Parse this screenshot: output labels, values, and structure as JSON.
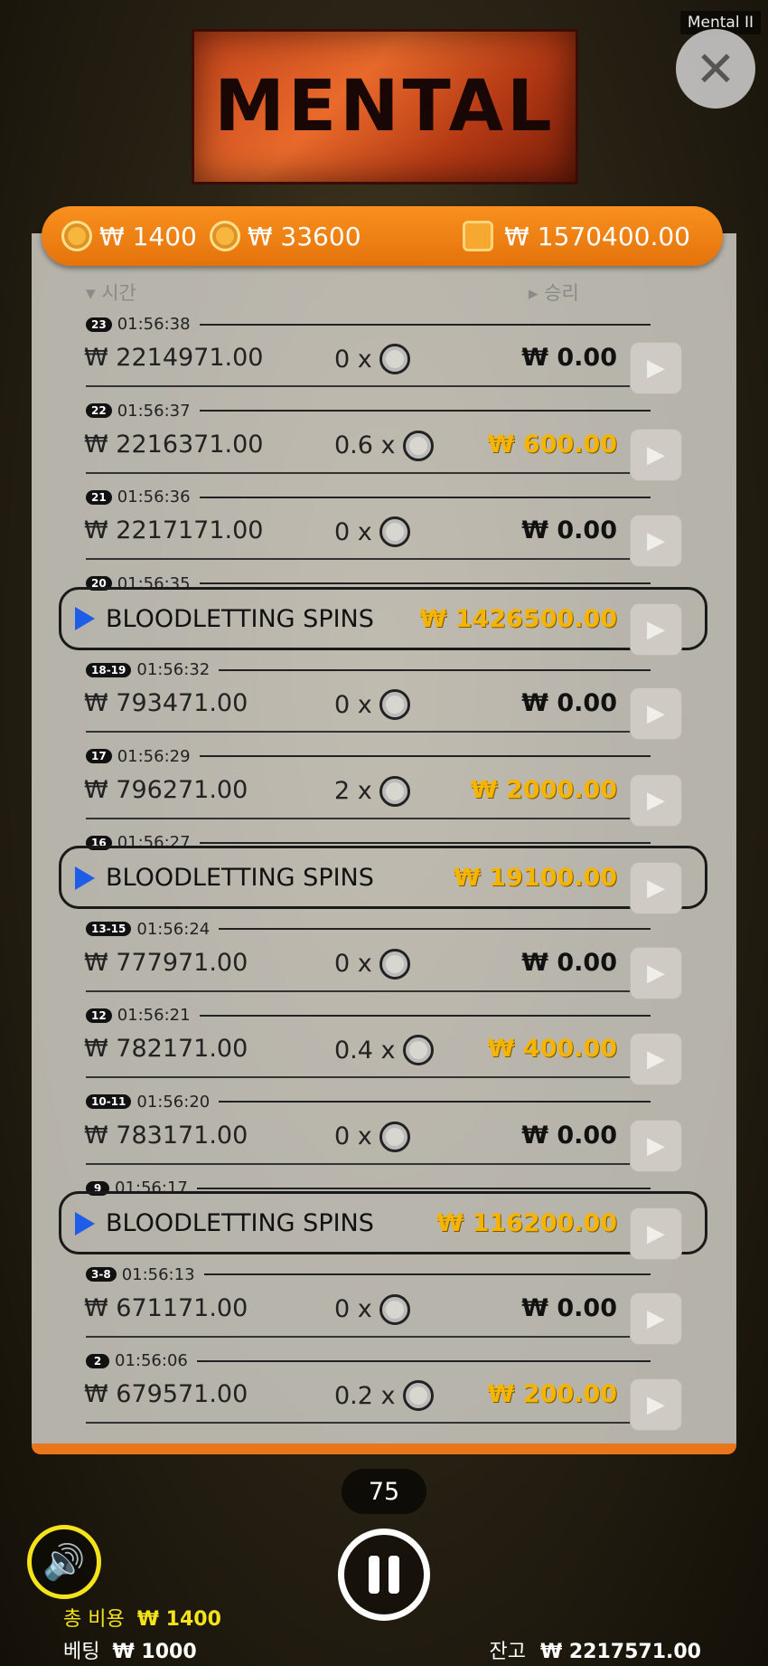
{
  "window": {
    "title": "Mental II"
  },
  "logo": {
    "text": "MENTAL"
  },
  "balance_bar": {
    "bet_coin_value": "₩ 1400",
    "second_coin_value": "₩ 33600",
    "wallet_value": "₩ 1570400.00"
  },
  "columns": {
    "time": "시간",
    "win": "승리"
  },
  "rounds": [
    {
      "badge": "23",
      "time": "01:56:38",
      "amount": "₩ 2214971.00",
      "multiplier": "0 x",
      "win": "₩ 0.00",
      "gold": false,
      "bonus": false
    },
    {
      "badge": "22",
      "time": "01:56:37",
      "amount": "₩ 2216371.00",
      "multiplier": "0.6 x",
      "win": "₩ 600.00",
      "gold": true,
      "bonus": false
    },
    {
      "badge": "21",
      "time": "01:56:36",
      "amount": "₩ 2217171.00",
      "multiplier": "0 x",
      "win": "₩ 0.00",
      "gold": false,
      "bonus": false
    },
    {
      "badge": "20",
      "time": "01:56:35",
      "label": "BLOODLETTING SPINS",
      "win": "₩ 1426500.00",
      "gold": true,
      "bonus": true
    },
    {
      "badge": "18-19",
      "time": "01:56:32",
      "amount": "₩ 793471.00",
      "multiplier": "0 x",
      "win": "₩ 0.00",
      "gold": false,
      "bonus": false
    },
    {
      "badge": "17",
      "time": "01:56:29",
      "amount": "₩ 796271.00",
      "multiplier": "2 x",
      "win": "₩ 2000.00",
      "gold": true,
      "bonus": false
    },
    {
      "badge": "16",
      "time": "01:56:27",
      "label": "BLOODLETTING SPINS",
      "win": "₩ 19100.00",
      "gold": true,
      "bonus": true
    },
    {
      "badge": "13-15",
      "time": "01:56:24",
      "amount": "₩ 777971.00",
      "multiplier": "0 x",
      "win": "₩ 0.00",
      "gold": false,
      "bonus": false
    },
    {
      "badge": "12",
      "time": "01:56:21",
      "amount": "₩ 782171.00",
      "multiplier": "0.4 x",
      "win": "₩ 400.00",
      "gold": true,
      "bonus": false
    },
    {
      "badge": "10-11",
      "time": "01:56:20",
      "amount": "₩ 783171.00",
      "multiplier": "0 x",
      "win": "₩ 0.00",
      "gold": false,
      "bonus": false
    },
    {
      "badge": "9",
      "time": "01:56:17",
      "label": "BLOODLETTING SPINS",
      "win": "₩ 116200.00",
      "gold": true,
      "bonus": true
    },
    {
      "badge": "3-8",
      "time": "01:56:13",
      "amount": "₩ 671171.00",
      "multiplier": "0 x",
      "win": "₩ 0.00",
      "gold": false,
      "bonus": false
    },
    {
      "badge": "2",
      "time": "01:56:06",
      "amount": "₩ 679571.00",
      "multiplier": "0.2 x",
      "win": "₩ 200.00",
      "gold": true,
      "bonus": false
    }
  ],
  "autoplay": {
    "count": "75"
  },
  "footer": {
    "total_cost_label": "총 비용",
    "total_cost_value": "₩ 1400",
    "bet_label": "베팅",
    "bet_value": "₩ 1000",
    "balance_label": "잔고",
    "balance_value": "₩ 2217571.00"
  },
  "colors": {
    "accent": "#e9761a",
    "gold": "#f5b400",
    "bonus_arrow": "#1e5de8",
    "sound": "#f4e21a"
  },
  "icons": {
    "close": "close-icon",
    "coin": "coin-icon",
    "wallet": "wallet-icon",
    "play": "play-icon",
    "sound": "speaker-icon",
    "pause": "pause-icon"
  }
}
